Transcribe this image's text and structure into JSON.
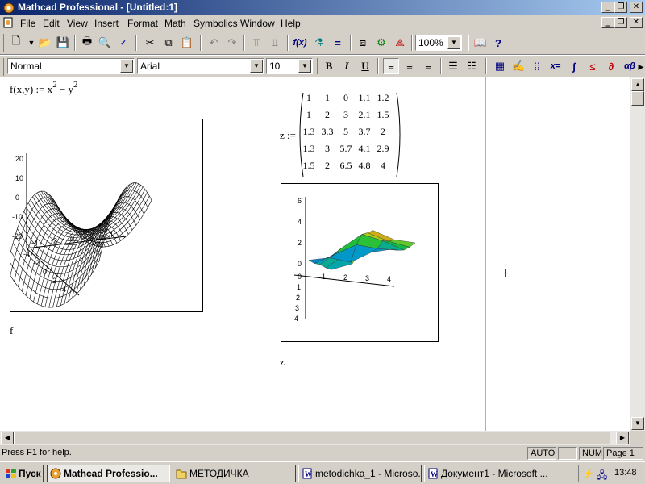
{
  "window": {
    "title": "Mathcad Professional - [Untitled:1]"
  },
  "menu": [
    "File",
    "Edit",
    "View",
    "Insert",
    "Format",
    "Math",
    "Symbolics",
    "Window",
    "Help"
  ],
  "toolbar": {
    "zoom": "100%"
  },
  "format_bar": {
    "style": "Normal",
    "font": "Arial",
    "size": "10",
    "bold": "B",
    "italic": "I",
    "underline": "U"
  },
  "worksheet": {
    "function_def": {
      "lhs": "f(x,y) := x",
      "exp1": "2",
      "mid": " − y",
      "exp2": "2"
    },
    "plot1_label": "f",
    "plot2_label": "z",
    "matrix_lhs": "z :=",
    "matrix": [
      [
        "1",
        "1",
        "0",
        "1.1",
        "1.2"
      ],
      [
        "1",
        "2",
        "3",
        "2.1",
        "1.5"
      ],
      [
        "1.3",
        "3.3",
        "5",
        "3.7",
        "2"
      ],
      [
        "1.3",
        "3",
        "5.7",
        "4.1",
        "2.9"
      ],
      [
        "1.5",
        "2",
        "6.5",
        "4.8",
        "4"
      ]
    ],
    "plot1_ticks_z": [
      "20",
      "10",
      "0",
      "-10",
      "-20"
    ],
    "plot1_ticks_x": [
      "-4",
      "-2",
      "0",
      "2",
      "4"
    ],
    "plot1_ticks_y": [
      "4",
      "2",
      "0",
      "-2",
      "-4"
    ],
    "plot2_ticks_z": [
      "6",
      "4",
      "2",
      "0"
    ],
    "plot2_ticks_x": [
      "1",
      "2",
      "3",
      "4"
    ],
    "plot2_ticks_y": [
      "0",
      "1",
      "2",
      "3",
      "4"
    ]
  },
  "status": {
    "help": "Press F1 for help.",
    "mode": "AUTO",
    "num": "NUM",
    "page": "Page 1"
  },
  "taskbar": {
    "start": "Пуск",
    "tasks": [
      "Mathcad Professio...",
      "МЕТОДИЧКА",
      "metodichka_1 - Microso...",
      "Документ1 - Microsoft ..."
    ],
    "clock": "13:48"
  },
  "colors": {
    "title_active": "#0a246a",
    "surface_mesh": "#000000",
    "cursor": "#cc0000"
  }
}
